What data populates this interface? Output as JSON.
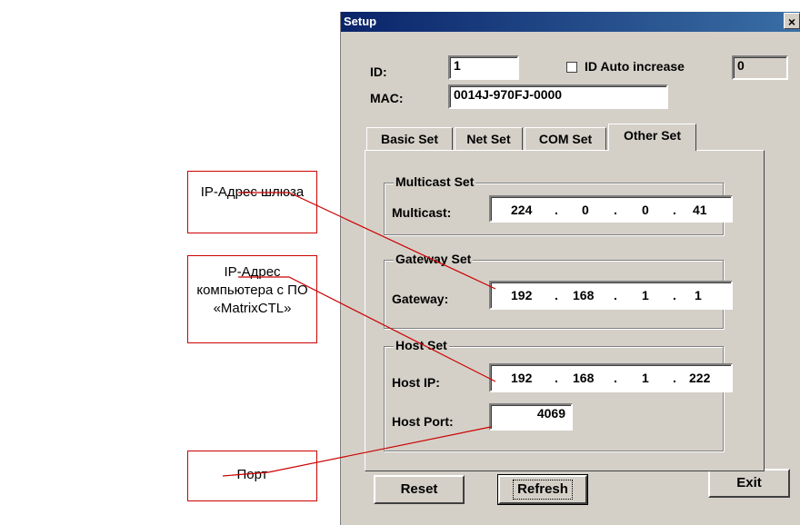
{
  "window": {
    "title": "Setup",
    "close_glyph": "×"
  },
  "header": {
    "id_label": "ID:",
    "id_value": "1",
    "auto_increase_label": "ID Auto increase",
    "auto_increase_checked": false,
    "auto_increase_value": "0",
    "mac_label": "MAC:",
    "mac_value": "0014J-970FJ-0000"
  },
  "tabs": [
    {
      "label": "Basic Set"
    },
    {
      "label": "Net Set"
    },
    {
      "label": "COM Set"
    },
    {
      "label": "Other Set",
      "active": true
    }
  ],
  "multicast": {
    "legend": "Multicast Set",
    "label": "Multicast:",
    "octets": [
      "224",
      "0",
      "0",
      "41"
    ]
  },
  "gateway": {
    "legend": "Gateway Set",
    "label": "Gateway:",
    "octets": [
      "192",
      "168",
      "1",
      "1"
    ]
  },
  "host": {
    "legend": "Host Set",
    "ip_label": "Host IP:",
    "octets": [
      "192",
      "168",
      "1",
      "222"
    ],
    "port_label": "Host Port:",
    "port_value": "4069"
  },
  "ip_separator": ".",
  "buttons": {
    "reset": "Reset",
    "refresh": "Refresh",
    "exit": "Exit"
  },
  "annotations": {
    "gateway_ip": "IP-Адрес шлюза",
    "host_ip_line1": "IP-Адрес",
    "host_ip_line2": "компьютера с ПО",
    "host_ip_line3": "«MatrixCTL»",
    "port": "Порт"
  },
  "colors": {
    "dialog": "#d4d0c8",
    "title_from": "#0a246a",
    "title_to": "#3a6ea5",
    "callout": "#cc0000"
  }
}
